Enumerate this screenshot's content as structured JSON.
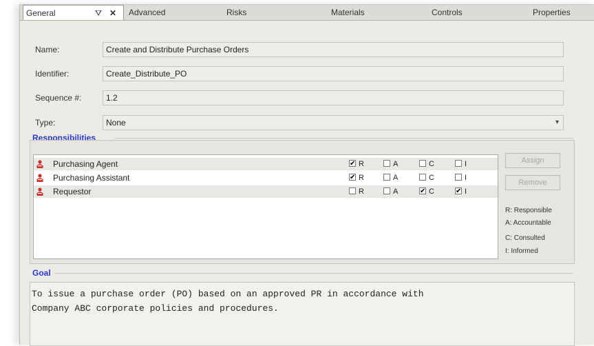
{
  "tabs": {
    "active": "General",
    "items": [
      "Advanced",
      "Risks",
      "Materials",
      "Controls",
      "Properties"
    ]
  },
  "fields": {
    "name_label": "Name:",
    "name_value": "Create and Distribute Purchase Orders",
    "identifier_label": "Identifier:",
    "identifier_value": "Create_Distribute_PO",
    "sequence_label": "Sequence #:",
    "sequence_value": "1.2",
    "type_label": "Type:",
    "type_value": "None"
  },
  "responsibilities": {
    "title": "Responsibilities",
    "columns": [
      "R",
      "A",
      "C",
      "I"
    ],
    "rows": [
      {
        "name": "Purchasing Agent",
        "R": true,
        "A": false,
        "C": false,
        "I": false
      },
      {
        "name": "Purchasing Assistant",
        "R": true,
        "A": false,
        "C": false,
        "I": false
      },
      {
        "name": "Requestor",
        "R": false,
        "A": false,
        "C": true,
        "I": true
      }
    ],
    "assign_label": "Assign",
    "remove_label": "Remove",
    "legend": [
      "R: Responsible",
      "A: Accountable",
      "C: Consulted",
      "I: Informed"
    ]
  },
  "goal": {
    "title": "Goal",
    "text": "To issue a purchase order (PO) based on an approved PR in accordance with\nCompany ABC corporate policies and procedures."
  },
  "icons": {
    "person": "person-icon",
    "filter": "filter-icon",
    "close": "close-icon",
    "dropdown": "chevron-down-icon"
  }
}
